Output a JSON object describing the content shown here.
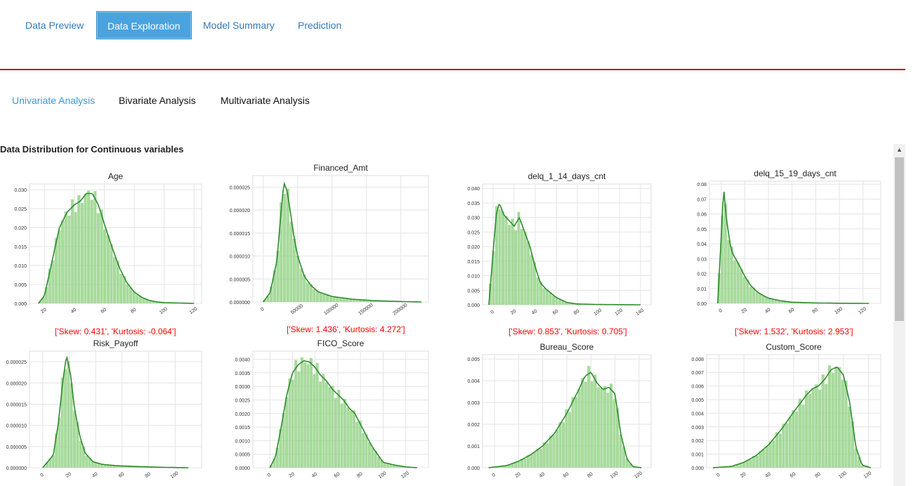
{
  "nav": {
    "tabs": [
      {
        "label": "Data Preview",
        "active": false
      },
      {
        "label": "Data Exploration",
        "active": true
      },
      {
        "label": "Model Summary",
        "active": false
      },
      {
        "label": "Prediction",
        "active": false
      }
    ]
  },
  "subnav": {
    "tabs": [
      {
        "label": "Univariate Analysis",
        "active": true
      },
      {
        "label": "Bivariate Analysis",
        "active": false
      },
      {
        "label": "Multivariate Analysis",
        "active": false
      }
    ]
  },
  "section": {
    "title": "Data Distribution for Continuous variables"
  },
  "colors": {
    "accent": "#337ab7",
    "active_tab": "#4aa3df",
    "divider": "#cc0000",
    "stat_text": "#ff0000",
    "bar_fill": "#98d48b",
    "kde_line": "#2e8b2e"
  },
  "chart_data": [
    {
      "type": "bar",
      "title": "Age",
      "xlim": [
        10,
        125
      ],
      "ylim": [
        0,
        0.0315
      ],
      "xticks": [
        "20",
        "40",
        "60",
        "80",
        "100",
        "120"
      ],
      "yticks": [
        "0.000",
        "0.005",
        "0.010",
        "0.015",
        "0.020",
        "0.025",
        "0.030"
      ],
      "kde_x": [
        16,
        20,
        25,
        30,
        35,
        40,
        44,
        48,
        52,
        56,
        60,
        65,
        70,
        75,
        80,
        85,
        90,
        95,
        100,
        110,
        120
      ],
      "kde_y": [
        0.0,
        0.002,
        0.011,
        0.02,
        0.024,
        0.026,
        0.027,
        0.029,
        0.029,
        0.026,
        0.021,
        0.015,
        0.0095,
        0.0055,
        0.003,
        0.0016,
        0.0008,
        0.0004,
        0.0002,
        0.0001,
        0.0
      ],
      "stats": "['Skew: 0.431', 'Kurtosis: -0.064']"
    },
    {
      "type": "bar",
      "title": "Financed_Amt",
      "xlim": [
        -15000,
        240000
      ],
      "ylim": [
        0,
        2.75e-05
      ],
      "xticks": [
        "0",
        "50000",
        "100000",
        "150000",
        "200000"
      ],
      "yticks": [
        "0.000000",
        "0.000005",
        "0.000010",
        "0.000015",
        "0.000020",
        "0.000025"
      ],
      "kde_x": [
        0,
        10000,
        20000,
        25000,
        30000,
        35000,
        40000,
        45000,
        50000,
        60000,
        70000,
        80000,
        100000,
        130000,
        160000,
        200000,
        230000
      ],
      "kde_y": [
        0.0,
        2e-06,
        9e-06,
        1.8e-05,
        2.6e-05,
        2.4e-05,
        1.9e-05,
        1.4e-05,
        1e-05,
        5.5e-06,
        3.5e-06,
        2.2e-06,
        1.2e-06,
        6e-07,
        3e-07,
        1e-07,
        0.0
      ],
      "stats": "['Skew: 1.436', 'Kurtosis: 4.272']"
    },
    {
      "type": "bar",
      "title": "delq_1_14_days_cnt",
      "xlim": [
        -10,
        150
      ],
      "ylim": [
        0,
        0.0415
      ],
      "xticks": [
        "0",
        "20",
        "40",
        "60",
        "80",
        "100",
        "120",
        "140"
      ],
      "yticks": [
        "0.000",
        "0.005",
        "0.010",
        "0.015",
        "0.020",
        "0.025",
        "0.030",
        "0.035",
        "0.040"
      ],
      "kde_x": [
        -4,
        0,
        3,
        6,
        10,
        15,
        20,
        25,
        30,
        35,
        40,
        45,
        50,
        55,
        60,
        70,
        80,
        100,
        140
      ],
      "kde_y": [
        0.0,
        0.018,
        0.031,
        0.035,
        0.031,
        0.029,
        0.027,
        0.03,
        0.025,
        0.02,
        0.013,
        0.0075,
        0.0055,
        0.004,
        0.0025,
        0.0008,
        0.0003,
        0.0001,
        0.0
      ],
      "stats": "['Skew: 0.853', 'Kurtosis: 0.705']"
    },
    {
      "type": "bar",
      "title": "delq_15_19_days_cnt",
      "xlim": [
        -10,
        135
      ],
      "ylim": [
        0,
        0.082
      ],
      "xticks": [
        "0",
        "20",
        "40",
        "60",
        "80",
        "100",
        "120"
      ],
      "yticks": [
        "0.00",
        "0.01",
        "0.02",
        "0.03",
        "0.04",
        "0.05",
        "0.06",
        "0.07",
        "0.08"
      ],
      "kde_x": [
        -3,
        0,
        2,
        4,
        6,
        8,
        10,
        15,
        20,
        25,
        30,
        35,
        40,
        50,
        60,
        80,
        100,
        125
      ],
      "kde_y": [
        0.0,
        0.045,
        0.078,
        0.06,
        0.048,
        0.038,
        0.033,
        0.026,
        0.018,
        0.012,
        0.008,
        0.0055,
        0.0035,
        0.0018,
        0.0008,
        0.0003,
        0.0001,
        0.0
      ],
      "stats": "['Skew: 1.532', 'Kurtosis: 2.953']"
    },
    {
      "type": "bar",
      "title": "Risk_Payoff",
      "xlim": [
        -10,
        120
      ],
      "ylim": [
        0,
        2.75e-05
      ],
      "xticks": [
        "0",
        "20",
        "40",
        "60",
        "80",
        "100"
      ],
      "yticks": [
        "0.000000",
        "0.000005",
        "0.000010",
        "0.000015",
        "0.000020",
        "0.000025"
      ],
      "kde_x": [
        0,
        8,
        12,
        15,
        18,
        21,
        24,
        28,
        32,
        38,
        45,
        55,
        70,
        90,
        110
      ],
      "kde_y": [
        0.0,
        3e-06,
        1.1e-05,
        2e-05,
        2.65e-05,
        2.2e-05,
        1.4e-05,
        7.5e-06,
        3.5e-06,
        1.4e-06,
        8e-07,
        5e-07,
        3e-07,
        1e-07,
        0.0
      ],
      "stats": ""
    },
    {
      "type": "bar",
      "title": "FICO_Score",
      "xlim": [
        -15,
        140
      ],
      "ylim": [
        0,
        0.0043
      ],
      "xticks": [
        "0",
        "20",
        "40",
        "60",
        "80",
        "100",
        "120"
      ],
      "yticks": [
        "0.0000",
        "0.0005",
        "0.0010",
        "0.0015",
        "0.0020",
        "0.0025",
        "0.0030",
        "0.0035",
        "0.0040"
      ],
      "kde_x": [
        0,
        5,
        10,
        15,
        20,
        25,
        30,
        35,
        40,
        45,
        50,
        55,
        60,
        65,
        70,
        75,
        80,
        85,
        90,
        95,
        100,
        110,
        120,
        130
      ],
      "kde_y": [
        0.0,
        0.0004,
        0.0015,
        0.0027,
        0.0035,
        0.0038,
        0.00395,
        0.0039,
        0.0037,
        0.0034,
        0.0032,
        0.0029,
        0.0027,
        0.0025,
        0.0022,
        0.002,
        0.0016,
        0.0012,
        0.0008,
        0.0005,
        0.0002,
        0.0001,
        3e-05,
        0.0
      ],
      "stats": ""
    },
    {
      "type": "bar",
      "title": "Bureau_Score",
      "xlim": [
        -10,
        130
      ],
      "ylim": [
        0,
        0.0052
      ],
      "xticks": [
        "0",
        "20",
        "40",
        "60",
        "80",
        "100",
        "120"
      ],
      "yticks": [
        "0.000",
        "0.001",
        "0.002",
        "0.003",
        "0.004",
        "0.005"
      ],
      "kde_x": [
        -5,
        10,
        20,
        30,
        40,
        50,
        60,
        70,
        75,
        80,
        85,
        90,
        95,
        100,
        105,
        110,
        115,
        122
      ],
      "kde_y": [
        0.0,
        0.0001,
        0.0003,
        0.0006,
        0.001,
        0.0016,
        0.0025,
        0.0036,
        0.0042,
        0.0044,
        0.0039,
        0.0036,
        0.0037,
        0.0034,
        0.0015,
        0.0004,
        5e-05,
        0.0
      ],
      "stats": ""
    },
    {
      "type": "bar",
      "title": "Custom_Score",
      "xlim": [
        -10,
        130
      ],
      "ylim": [
        0,
        0.0083
      ],
      "xticks": [
        "0",
        "20",
        "40",
        "60",
        "80",
        "100",
        "120"
      ],
      "yticks": [
        "0.000",
        "0.001",
        "0.002",
        "0.003",
        "0.004",
        "0.005",
        "0.006",
        "0.007",
        "0.008"
      ],
      "kde_x": [
        -5,
        10,
        20,
        30,
        40,
        50,
        60,
        70,
        75,
        80,
        85,
        90,
        95,
        100,
        105,
        110,
        115,
        122
      ],
      "kde_y": [
        0.0,
        0.0001,
        0.0004,
        0.0009,
        0.0017,
        0.0028,
        0.0041,
        0.0053,
        0.0058,
        0.006,
        0.0065,
        0.0072,
        0.0074,
        0.0068,
        0.0048,
        0.0015,
        0.0002,
        0.0
      ],
      "stats": ""
    }
  ]
}
